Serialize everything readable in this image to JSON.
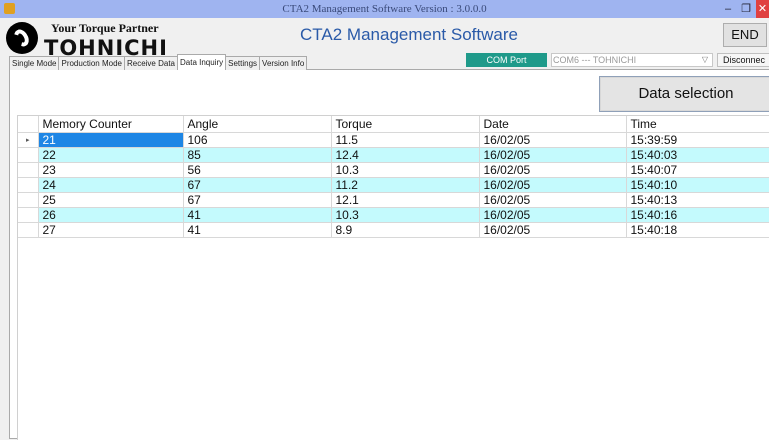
{
  "window": {
    "title": "CTA2 Management Software  Version : 3.0.0.0",
    "minimize_glyph": "–",
    "maximize_glyph": "❐",
    "close_glyph": "✕"
  },
  "header": {
    "tagline": "Your Torque Partner",
    "brand": "TOHNICHI",
    "app_title": "CTA2 Management Software",
    "end_label": "END"
  },
  "tabs": [
    {
      "label": "Single Mode"
    },
    {
      "label": "Production Mode"
    },
    {
      "label": "Receive Data"
    },
    {
      "label": "Data Inquiry",
      "active": true
    },
    {
      "label": "Settings"
    },
    {
      "label": "Version Info"
    }
  ],
  "com": {
    "port_label": "COM Port",
    "selected": "COM6 --- TOHNICHI",
    "disconnect_label": "Disconnec"
  },
  "data_selection_label": "Data selection",
  "table": {
    "columns": [
      "Memory Counter",
      "Angle",
      "Torque",
      "Date",
      "Time"
    ],
    "current_row_marker": "▸",
    "rows": [
      [
        "21",
        "106",
        "11.5",
        "16/02/05",
        "15:39:59"
      ],
      [
        "22",
        "85",
        "12.4",
        "16/02/05",
        "15:40:03"
      ],
      [
        "23",
        "56",
        "10.3",
        "16/02/05",
        "15:40:07"
      ],
      [
        "24",
        "67",
        "11.2",
        "16/02/05",
        "15:40:10"
      ],
      [
        "25",
        "67",
        "12.1",
        "16/02/05",
        "15:40:13"
      ],
      [
        "26",
        "41",
        "10.3",
        "16/02/05",
        "15:40:16"
      ],
      [
        "27",
        "41",
        "8.9",
        "16/02/05",
        "15:40:18"
      ]
    ]
  },
  "colors": {
    "titlebar": "#9fb4f0",
    "accent_teal": "#1f9a8a",
    "row_alt": "#c4fafd",
    "selection": "#1e86e5"
  }
}
